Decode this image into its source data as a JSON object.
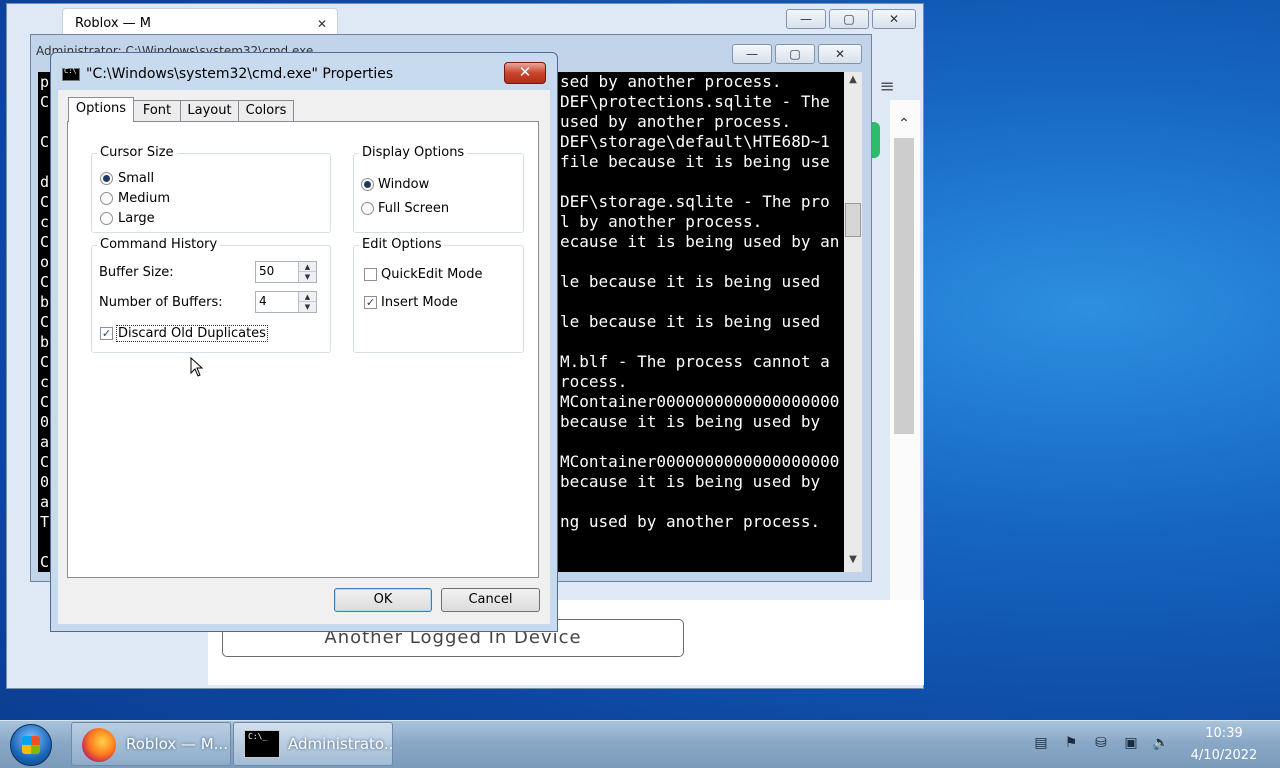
{
  "firefox": {
    "tab_title": "Roblox — M",
    "tab_close": "✕",
    "min": "—",
    "max": "▢",
    "close": "✕",
    "menu_icon": "≡",
    "device_button": "Another Logged In Device",
    "scroll_up": "⌃",
    "scroll_down": "⌄"
  },
  "cmd_window": {
    "title": "Administrator: C:\\Windows\\system32\\cmd.exe",
    "min": "—",
    "max": "▢",
    "close": "✕",
    "left_column": [
      "p",
      "C",
      "",
      "C",
      "",
      "d",
      "C",
      "c",
      "C",
      "o",
      "C",
      "b",
      "C",
      "b",
      "C",
      "c",
      "C",
      "0",
      "a",
      "C",
      "0",
      "a",
      "T",
      "",
      "C"
    ],
    "lines": [
      "sed by another process.",
      "DEF\\protections.sqlite - The",
      "used by another process.",
      "DEF\\storage\\default\\HTE68D~1",
      "file because it is being use",
      "",
      "DEF\\storage.sqlite - The pro",
      "l by another process.",
      "ecause it is being used by an",
      "",
      "le because it is being used",
      "",
      "le because it is being used",
      "",
      "M.blf - The process cannot a",
      "rocess.",
      "MContainer0000000000000000000",
      "because it is being used by",
      "",
      "MContainer0000000000000000000",
      "because it is being used by",
      "",
      "ng used by another process."
    ],
    "scroll_up": "▲",
    "scroll_down": "▼"
  },
  "dialog": {
    "title": "\"C:\\Windows\\system32\\cmd.exe\" Properties",
    "close": "✕",
    "tabs": [
      "Options",
      "Font",
      "Layout",
      "Colors"
    ],
    "cursor_size": {
      "label": "Cursor Size",
      "options": [
        "Small",
        "Medium",
        "Large"
      ],
      "selected": "Small"
    },
    "display_options": {
      "label": "Display Options",
      "options": [
        "Window",
        "Full Screen"
      ],
      "selected": "Window"
    },
    "command_history": {
      "label": "Command History",
      "buffer_size_label": "Buffer Size:",
      "buffer_size": "50",
      "num_buffers_label": "Number of Buffers:",
      "num_buffers": "4",
      "discard_label": "Discard Old Duplicates",
      "discard_checked": true,
      "spin_up": "▲",
      "spin_down": "▼"
    },
    "edit_options": {
      "label": "Edit Options",
      "quickedit_label": "QuickEdit Mode",
      "quickedit_checked": false,
      "insert_label": "Insert Mode",
      "insert_checked": true,
      "check_mark": "✓"
    },
    "ok_label": "OK",
    "cancel_label": "Cancel"
  },
  "taskbar": {
    "firefox_label": "Roblox — M...",
    "cmd_label": "Administrato...",
    "tray_icons": [
      "document-icon",
      "flag-icon",
      "network-drive-icon",
      "network-icon",
      "volume-muted-icon"
    ],
    "time": "10:39",
    "date": "4/10/2022"
  }
}
